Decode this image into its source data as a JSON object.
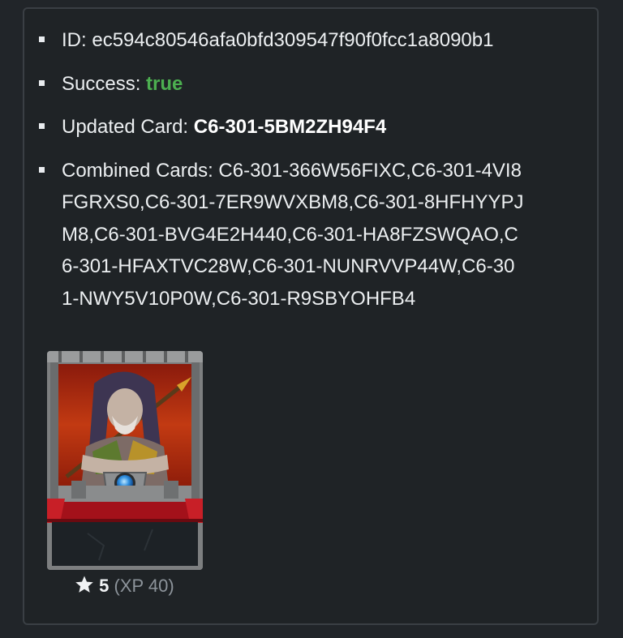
{
  "details": {
    "id_label": "ID:",
    "id_value": "ec594c80546afa0bfd309547f90f0fcc1a8090b1",
    "success_label": "Success:",
    "success_value": "true",
    "updated_label": "Updated Card:",
    "updated_value": "C6-301-5BM2ZH94F4",
    "combined_label": "Combined Cards:",
    "combined_value": "C6-301-366W56FIXC,C6-301-4VI8FGRXS0,C6-301-7ER9WVXBM8,C6-301-8HFHYYPJM8,C6-301-BVG4E2H440,C6-301-HA8FZSWQAO,C6-301-HFAXTVC28W,C6-301-NUNRVVP44W,C6-301-NWY5V10P0W,C6-301-R9SBYOHFB4"
  },
  "card": {
    "image_icon": "monster-card-illustration",
    "star_icon": "star-icon",
    "level": "5",
    "xp_text": "(XP 40)"
  },
  "colors": {
    "background": "#212529",
    "success": "#4caf50",
    "border": "#3a3f44"
  }
}
